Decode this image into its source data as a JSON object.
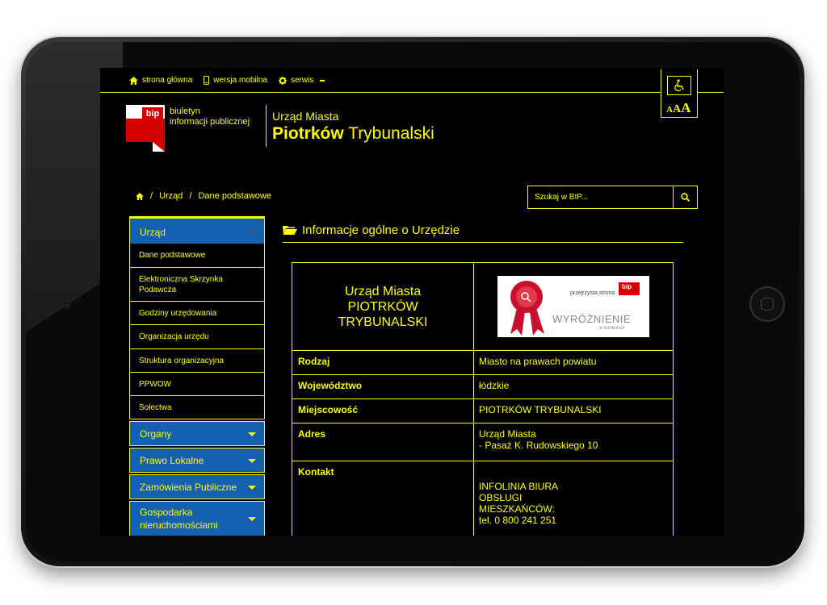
{
  "topnav": {
    "home": "strona główna",
    "mobile": "wersja mobilna",
    "service": "serwis"
  },
  "accessibility": {
    "font_sizes": [
      "A",
      "A",
      "A"
    ]
  },
  "logo": {
    "bip_mark": "bip",
    "line1": "biuletyn",
    "line2": "informacji publicznej"
  },
  "org": {
    "line1": "Urząd Miasta",
    "line2_bold": "Piotrków",
    "line2_rest": " Trybunalski"
  },
  "breadcrumb": {
    "sep": "/",
    "level1": "Urząd",
    "level2": "Dane podstawowe"
  },
  "search": {
    "placeholder": "Szukaj w BIP..."
  },
  "sidebar": {
    "head": "Urząd",
    "sub_items": [
      "Dane podstawowe",
      "Elektroniczna Skrzynka Podawcza",
      "Godziny urzędowania",
      "Organizacja urzędu",
      "Struktura organizacyjna",
      "PPWOW",
      "Sołectwa"
    ],
    "categories": [
      "Organy",
      "Prawo Lokalne",
      "Zamówienia Publiczne",
      "Gospodarka nieruchomościami"
    ]
  },
  "main": {
    "title": "Informacje ogólne o Urzędzie",
    "table_head": {
      "line1": "Urząd Miasta",
      "line2": "PIOTRKÓW",
      "line3": "TRYBUNALSKI"
    },
    "award": {
      "small": "przejrzysta strona",
      "mark": "bip",
      "big": "WYRÓŻNIENIE",
      "tiny": "w konkursie"
    },
    "rows": [
      {
        "label": "Rodzaj",
        "value": "Miasto na prawach powiatu"
      },
      {
        "label": "Województwo",
        "value": "łódzkie"
      },
      {
        "label": "Miejscowość",
        "value": "PIOTRKÓW TRYBUNALSKI"
      },
      {
        "label": "Adres",
        "value": "Urząd Miasta",
        "value2": "- Pasaż K. Rudowskiego 10"
      },
      {
        "label": "Kontakt",
        "value": "INFOLINIA BIURA OBSŁUGI MIESZKAŃCÓW:",
        "value2": "tel. 0 800 241 251"
      }
    ]
  },
  "colors": {
    "accent": "#ffff00",
    "background": "#000000",
    "nav_blue": "#1360b0",
    "bip_red": "#d50000"
  }
}
